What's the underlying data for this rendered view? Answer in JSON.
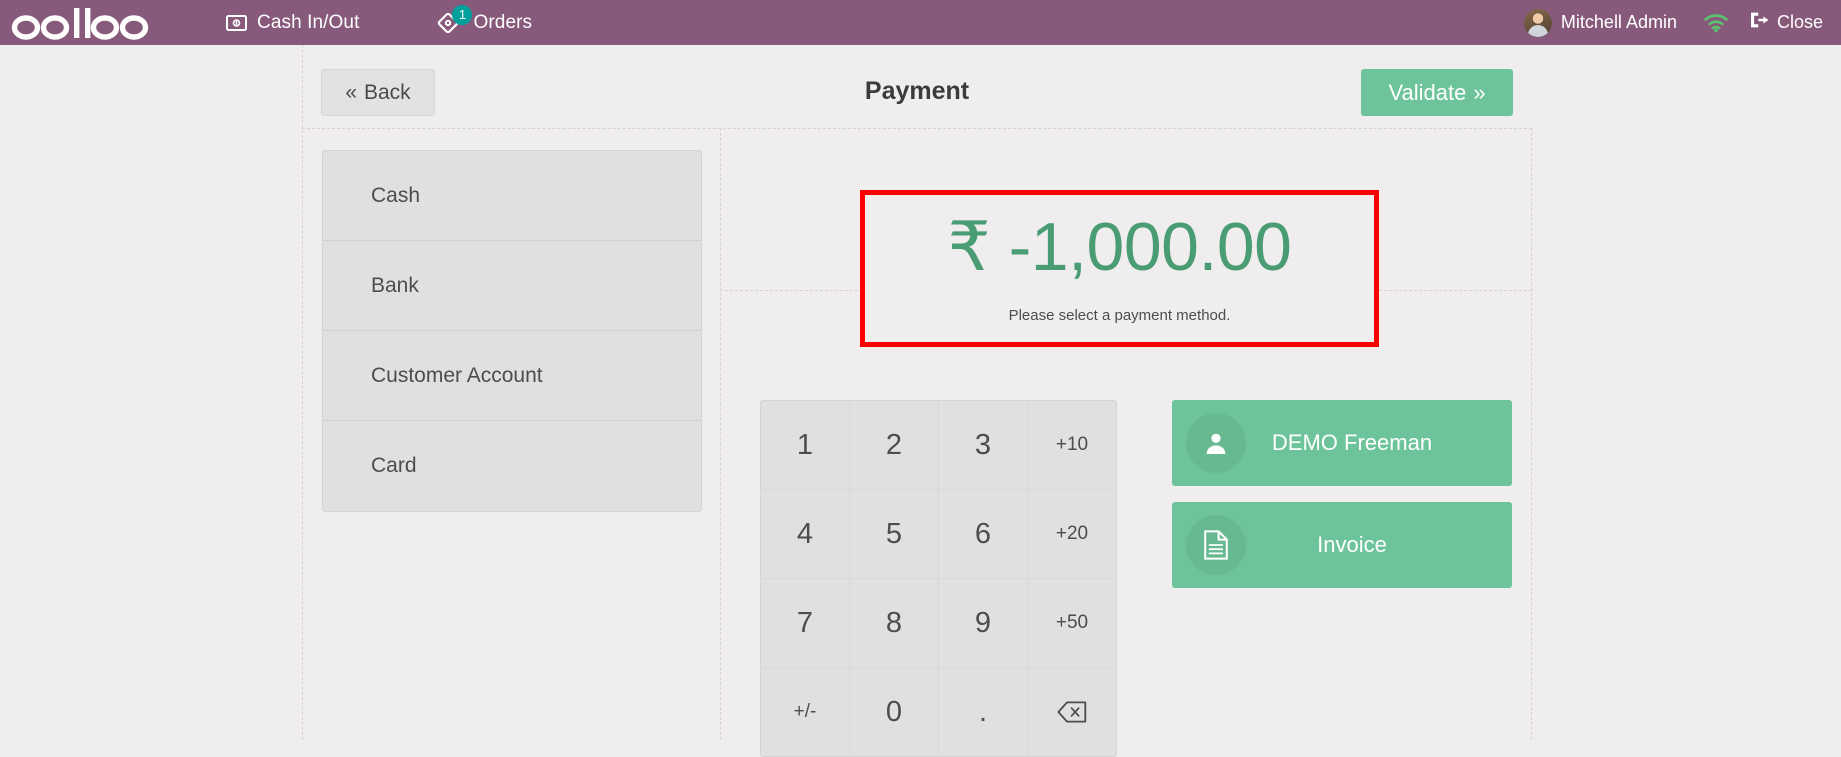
{
  "topbar": {
    "brand": "odoo",
    "cash_in_out_label": "Cash In/Out",
    "orders_label": "Orders",
    "orders_badge": "1",
    "user_name": "Mitchell Admin",
    "close_label": "Close",
    "accent_color": "#875a7b",
    "badge_color": "#00a09d",
    "wifi_color": "#5bc46f"
  },
  "header": {
    "back_label": "Back",
    "back_chevron": "«",
    "title": "Payment",
    "validate_label": "Validate",
    "validate_chevron": "»",
    "validate_color": "#6dc49a"
  },
  "payment_methods": {
    "items": [
      {
        "label": "Cash"
      },
      {
        "label": "Bank"
      },
      {
        "label": "Customer Account"
      },
      {
        "label": "Card"
      }
    ]
  },
  "amount_panel": {
    "currency_symbol": "₹",
    "amount": "-1,000.00",
    "display": "₹ -1,000.00",
    "hint": "Please select a payment method.",
    "amount_color": "#4a9d73",
    "highlight_color": "#fc0000"
  },
  "numpad": {
    "keys": [
      {
        "label": "1",
        "name": "numpad-key-1",
        "style": "digit"
      },
      {
        "label": "2",
        "name": "numpad-key-2",
        "style": "digit"
      },
      {
        "label": "3",
        "name": "numpad-key-3",
        "style": "digit"
      },
      {
        "label": "+10",
        "name": "numpad-key-plus-10",
        "style": "small"
      },
      {
        "label": "4",
        "name": "numpad-key-4",
        "style": "digit"
      },
      {
        "label": "5",
        "name": "numpad-key-5",
        "style": "digit"
      },
      {
        "label": "6",
        "name": "numpad-key-6",
        "style": "digit"
      },
      {
        "label": "+20",
        "name": "numpad-key-plus-20",
        "style": "small"
      },
      {
        "label": "7",
        "name": "numpad-key-7",
        "style": "digit"
      },
      {
        "label": "8",
        "name": "numpad-key-8",
        "style": "digit"
      },
      {
        "label": "9",
        "name": "numpad-key-9",
        "style": "digit"
      },
      {
        "label": "+50",
        "name": "numpad-key-plus-50",
        "style": "small"
      },
      {
        "label": "+/-",
        "name": "numpad-key-sign-toggle",
        "style": "small"
      },
      {
        "label": "0",
        "name": "numpad-key-0",
        "style": "digit"
      },
      {
        "label": ".",
        "name": "numpad-key-decimal",
        "style": "digit"
      },
      {
        "label": "",
        "name": "numpad-key-backspace",
        "style": "icon",
        "icon": "backspace-icon"
      }
    ]
  },
  "actions": {
    "customer_label": "DEMO Freeman",
    "customer_icon": "user-icon",
    "invoice_label": "Invoice",
    "invoice_icon": "document-icon",
    "button_color": "#6dc49a"
  }
}
